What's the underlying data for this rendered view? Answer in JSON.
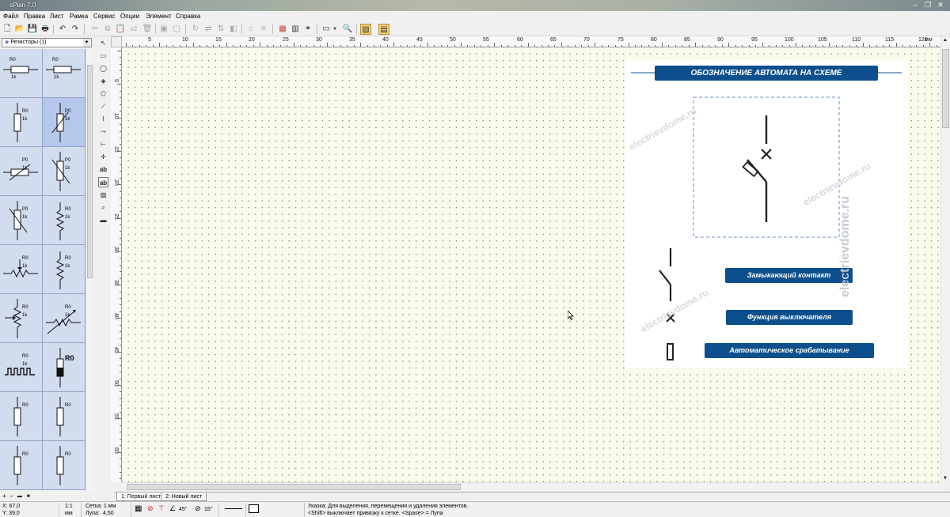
{
  "window": {
    "title": "sPlan 7.0"
  },
  "menu": [
    "Файл",
    "Правка",
    "Лист",
    "Рамка",
    "Сервис",
    "Опции",
    "Элемент",
    "Справка"
  ],
  "toolbar": {
    "copies_label": "x2"
  },
  "library": {
    "selected": "Резисторы (1)",
    "items": [
      {
        "r": "R0",
        "v": "1k"
      },
      {
        "r": "R0",
        "v": "1k"
      },
      {
        "r": "R0",
        "v": "1k"
      },
      {
        "r": "P0",
        "v": "1k"
      },
      {
        "r": "P0",
        "v": "1k"
      },
      {
        "r": "P0",
        "v": "1k"
      },
      {
        "r": "P0",
        "v": "1k"
      },
      {
        "r": "R0",
        "v": "1k"
      },
      {
        "r": "R0",
        "v": "1k"
      },
      {
        "r": "R0",
        "v": "1k"
      },
      {
        "r": "R0",
        "v": "1k"
      },
      {
        "r": "R0",
        "v": "1k"
      },
      {
        "r": "R0",
        "v": "1k"
      },
      {
        "r": "R0",
        "v": ""
      },
      {
        "r": "R0",
        "v": ""
      },
      {
        "r": "R0",
        "v": ""
      },
      {
        "r": "R0",
        "v": ""
      },
      {
        "r": "R0",
        "v": ""
      }
    ]
  },
  "rulers": {
    "top": [
      "5",
      "10",
      "15",
      "20",
      "25",
      "30",
      "35",
      "40",
      "45",
      "50",
      "55",
      "60",
      "65",
      "70",
      "75",
      "80",
      "85",
      "90",
      "95",
      "100",
      "105",
      "110",
      "115",
      "120",
      "мм"
    ],
    "left": [
      "5",
      "10",
      "15",
      "20",
      "25",
      "30",
      "35",
      "40",
      "45",
      "50",
      "55",
      "60"
    ]
  },
  "picture": {
    "title": "ОБОЗНАЧЕНИЕ АВТОМАТА НА СХЕМЕ",
    "legend": [
      "Замыкающий контакт",
      "Функция выключателя",
      "Автоматическое срабатывание"
    ],
    "watermark": "electrievdome.ru"
  },
  "sheets": [
    "1: Первый лист",
    "2: Новый лист"
  ],
  "status": {
    "x": "X: 67,0",
    "y": "Y: 39,0",
    "scale": "1:1",
    "unit": "мм",
    "grid": "Сетка: 1 мм",
    "zoom_label": "Лупа:",
    "zoom_value": "4,50",
    "angle1": "45°",
    "angle2": "15°",
    "hint1": "Указка: Для выделения, перемещения и удаления элементов.",
    "hint2": "<Shift> выключает привязку к сетке. <Spase> = Лупа"
  },
  "colors": {
    "banner": "#0d4f8c",
    "canvas": "#fbfbeb",
    "library_cell": "#d2dcef",
    "selection_frame": "#6b8fc9"
  }
}
